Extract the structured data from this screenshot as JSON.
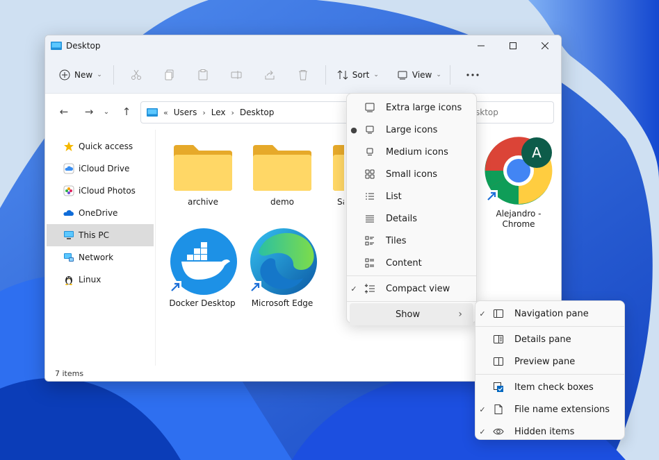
{
  "window": {
    "title": "Desktop"
  },
  "toolbar": {
    "new_label": "New",
    "sort_label": "Sort",
    "view_label": "View"
  },
  "address": {
    "overflow": "«",
    "crumbs": [
      "Users",
      "Lex",
      "Desktop"
    ]
  },
  "search": {
    "placeholder": "sktop"
  },
  "sidebar": {
    "items": [
      {
        "label": "Quick access",
        "icon": "star-icon"
      },
      {
        "label": "iCloud Drive",
        "icon": "icloud-icon"
      },
      {
        "label": "iCloud Photos",
        "icon": "photos-icon"
      },
      {
        "label": "OneDrive",
        "icon": "onedrive-icon"
      },
      {
        "label": "This PC",
        "icon": "pc-icon"
      },
      {
        "label": "Network",
        "icon": "network-icon"
      },
      {
        "label": "Linux",
        "icon": "linux-icon"
      }
    ]
  },
  "files": [
    {
      "label": "archive",
      "icon": "folder-icon"
    },
    {
      "label": "demo",
      "icon": "folder-icon"
    },
    {
      "label": "Sa",
      "icon": "folder-icon"
    },
    {
      "label": "Alejandro - Chrome",
      "icon": "chrome-icon",
      "avatar_letter": "A"
    },
    {
      "label": "Docker Desktop",
      "icon": "docker-icon"
    },
    {
      "label": "Microsoft Edge",
      "icon": "edge-icon"
    }
  ],
  "status": {
    "count": "7 items"
  },
  "view_menu": {
    "items": [
      {
        "label": "Extra large icons",
        "checked": false
      },
      {
        "label": "Large icons",
        "checked": true
      },
      {
        "label": "Medium icons",
        "checked": false
      },
      {
        "label": "Small icons",
        "checked": false
      },
      {
        "label": "List",
        "checked": false
      },
      {
        "label": "Details",
        "checked": false
      },
      {
        "label": "Tiles",
        "checked": false
      },
      {
        "label": "Content",
        "checked": false
      },
      {
        "label": "Compact view",
        "checked": true
      },
      {
        "label": "Show",
        "checked": false
      }
    ]
  },
  "show_menu": {
    "items": [
      {
        "label": "Navigation pane",
        "checked": true
      },
      {
        "label": "Details pane",
        "checked": false
      },
      {
        "label": "Preview pane",
        "checked": false
      },
      {
        "label": "Item check boxes",
        "checked": false
      },
      {
        "label": "File name extensions",
        "checked": true
      },
      {
        "label": "Hidden items",
        "checked": true
      }
    ]
  },
  "colors": {
    "accent": "#0067c0",
    "folder": "#f8c94a",
    "selected": "#dcdcdc"
  }
}
